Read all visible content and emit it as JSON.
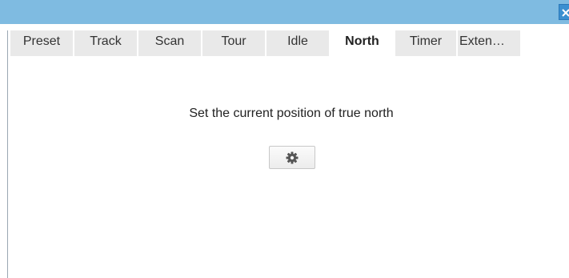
{
  "window": {
    "close_icon": "close-icon",
    "colors": {
      "titlebar": "#7fbbe1",
      "close_button": "#3b8fd0",
      "tab_background": "#e9e9e9",
      "active_tab_background": "#ffffff"
    }
  },
  "tabs": [
    {
      "label": "Preset",
      "active": false
    },
    {
      "label": "Track",
      "active": false
    },
    {
      "label": "Scan",
      "active": false
    },
    {
      "label": "Tour",
      "active": false
    },
    {
      "label": "Idle",
      "active": false
    },
    {
      "label": "North",
      "active": true
    },
    {
      "label": "Timer",
      "active": false
    },
    {
      "label": "Exten…",
      "active": false
    }
  ],
  "north_panel": {
    "message": "Set the current position of true north",
    "set_button_icon": "gear-icon"
  }
}
